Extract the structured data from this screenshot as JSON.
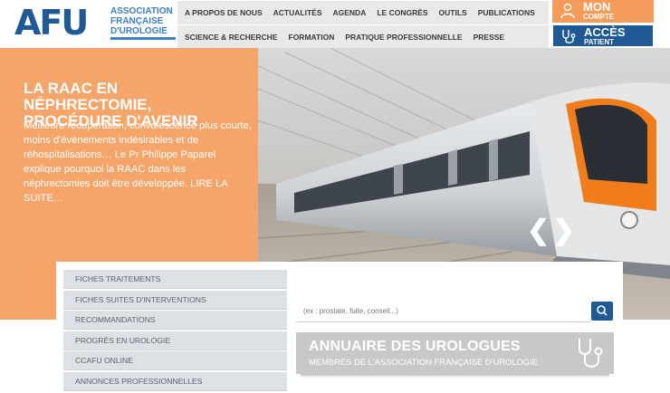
{
  "logo": {
    "brand": "AFU",
    "lines": [
      "ASSOCIATION",
      "FRANÇAISE",
      "D'UROLOGIE"
    ]
  },
  "nav": {
    "row1": [
      "A PROPOS DE NOUS",
      "ACTUALITÉS",
      "AGENDA",
      "LE CONGRÈS",
      "OUTILS",
      "PUBLICATIONS"
    ],
    "row2": [
      "SCIENCE & RECHERCHE",
      "FORMATION",
      "PRATIQUE PROFESSIONNELLE",
      "PRESSE"
    ]
  },
  "buttons": {
    "mon_compte": {
      "big": "MON",
      "small": "COMPTE",
      "icon": "user-doctor-icon"
    },
    "acces_patient": {
      "big": "ACCÈS",
      "small": "PATIENT",
      "icon": "stethoscope-icon"
    }
  },
  "hero": {
    "title": "LA RAAC EN NÉPHRECTOMIE, PROCÉDURE D'AVENIR",
    "text": "Meilleure récupération, convalescence plus courte, moins d'évènements indésirables et de réhospitalisations… Le Pr Philippe Paparel explique pourquoi la RAAC dans les néphrectomies doit être développée. LIRE LA SUITE…",
    "prev_arrow": "❮",
    "next_arrow": "❯"
  },
  "menu": {
    "items": [
      "FICHES TRAITEMENTS",
      "FICHES SUITES D'INTERVENTIONS",
      "RECOMMANDATIONS",
      "PROGRÈS EN UROLOGIE",
      "CCAFU ONLINE",
      "ANNONCES PROFESSIONNELLES"
    ]
  },
  "search": {
    "placeholder": "(ex : prostate, fuite, conseil...)",
    "icon": "search-icon"
  },
  "annuaire": {
    "title": "ANNUAIRE DES UROLOGUES",
    "subtitle": "MEMBRES DE L'ASSOCIATION FRANÇAISE D'UROLOGIE",
    "icon": "stethoscope-icon"
  },
  "colors": {
    "brand_blue": "#1f5a97",
    "orange": "#f6a56a",
    "nav_gray": "#e9e9e9"
  }
}
